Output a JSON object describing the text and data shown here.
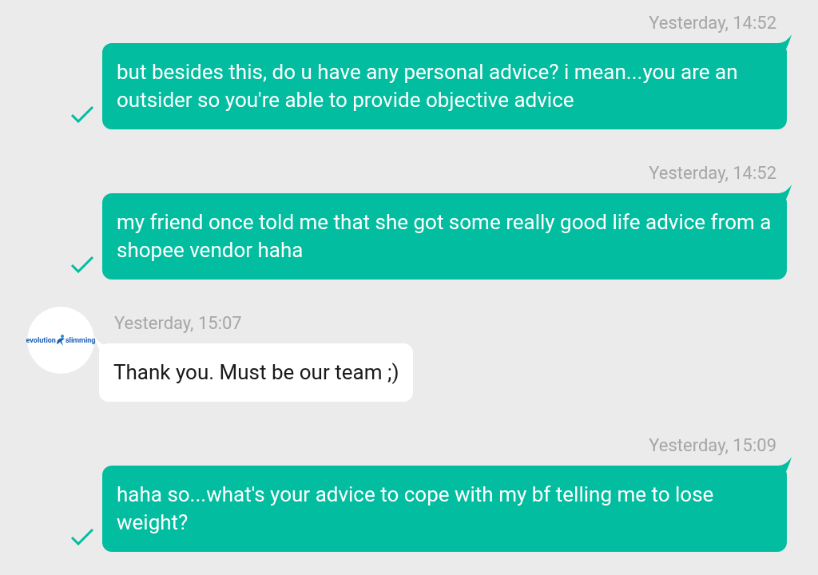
{
  "messages": [
    {
      "kind": "outgoing",
      "time": "Yesterday, 14:52",
      "text": "but besides this, do u have any personal advice? i mean...you are an outsider so you're able to provide objective advice",
      "delivered": true
    },
    {
      "kind": "outgoing",
      "time": "Yesterday, 14:52",
      "text": "my friend once told me that she got some really good life advice from a shopee vendor haha",
      "delivered": true
    },
    {
      "kind": "incoming",
      "time": "Yesterday, 15:07",
      "text": "Thank you. Must be our team ;)",
      "avatar": {
        "logo_left": "evolution",
        "logo_right": "slimming"
      }
    },
    {
      "kind": "outgoing",
      "time": "Yesterday, 15:09",
      "text": "haha so...what's your advice to cope with my bf telling me to lose weight?",
      "delivered": true
    }
  ]
}
